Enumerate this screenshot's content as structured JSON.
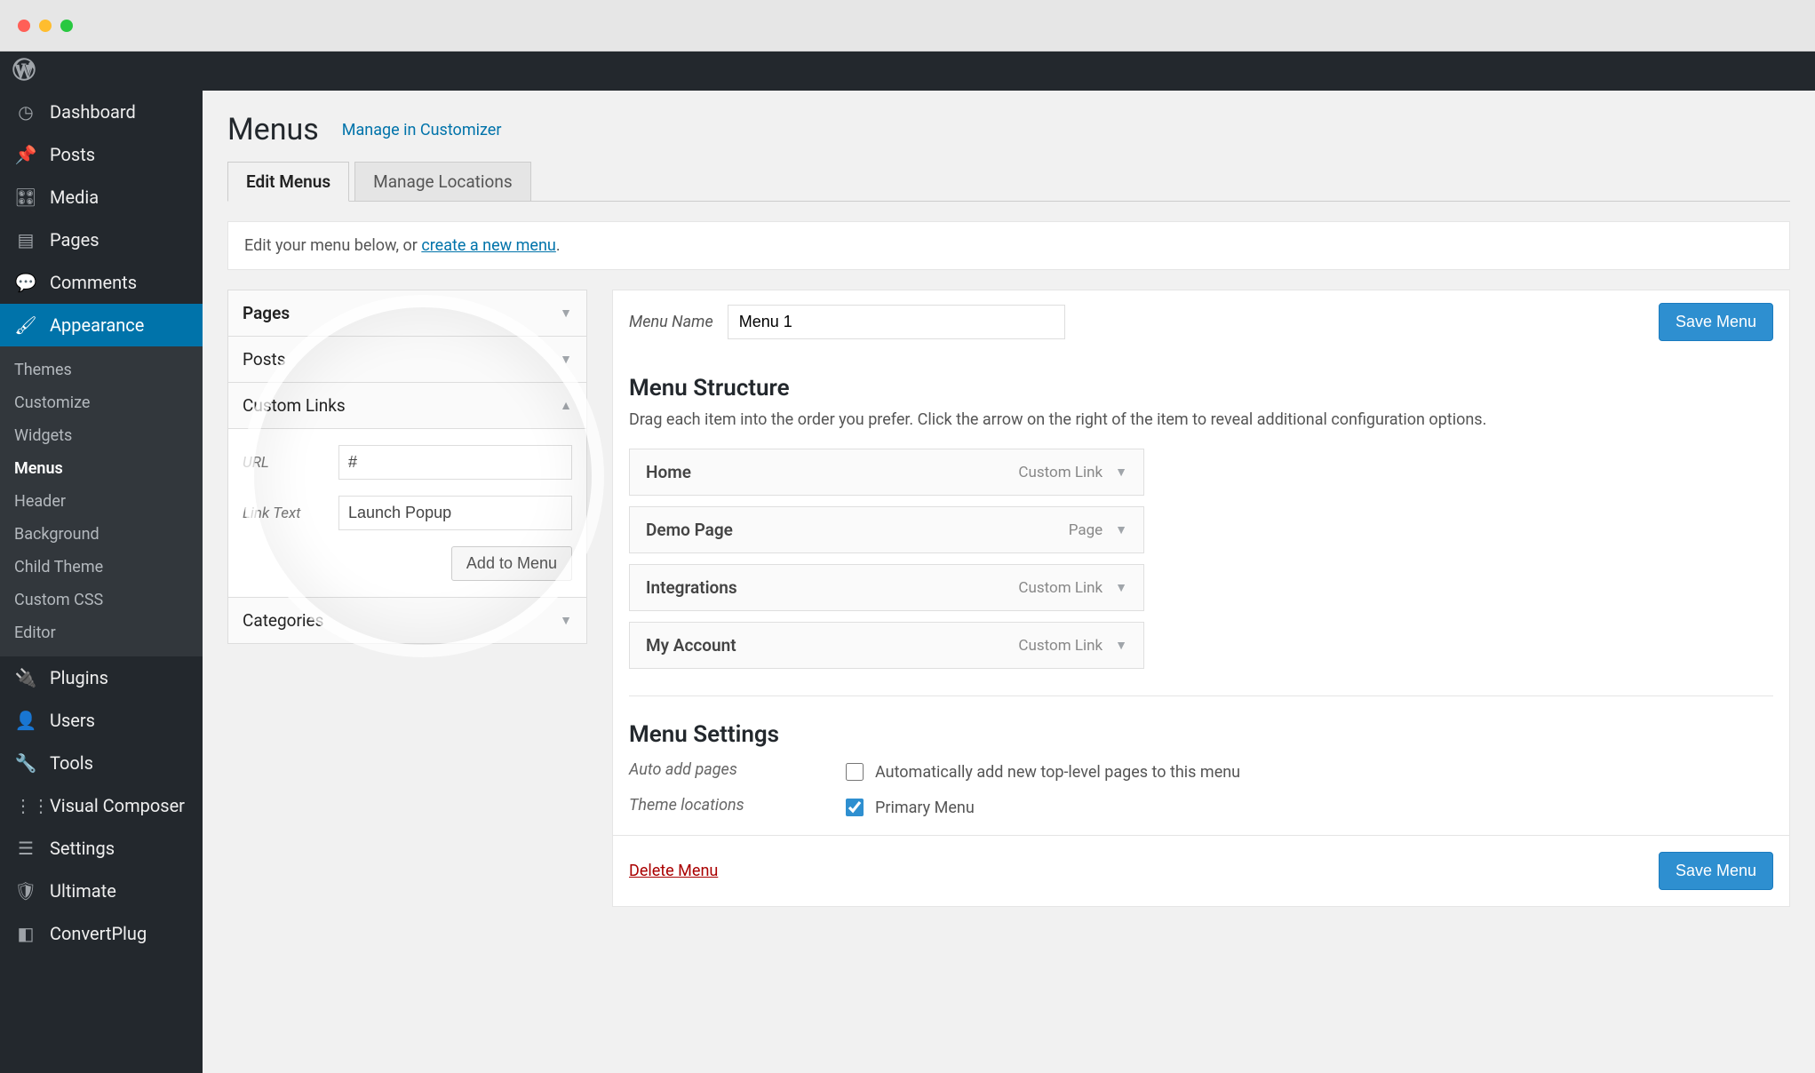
{
  "sidebar": {
    "items": [
      {
        "icon": "gauge",
        "label": "Dashboard"
      },
      {
        "icon": "pin",
        "label": "Posts"
      },
      {
        "icon": "media",
        "label": "Media"
      },
      {
        "icon": "pages",
        "label": "Pages"
      },
      {
        "icon": "comment",
        "label": "Comments"
      },
      {
        "icon": "brush",
        "label": "Appearance",
        "active": true
      },
      {
        "icon": "plug",
        "label": "Plugins"
      },
      {
        "icon": "user",
        "label": "Users"
      },
      {
        "icon": "wrench",
        "label": "Tools"
      },
      {
        "icon": "vc",
        "label": "Visual Composer"
      },
      {
        "icon": "sliders",
        "label": "Settings"
      },
      {
        "icon": "shield",
        "label": "Ultimate"
      },
      {
        "icon": "cp",
        "label": "ConvertPlug"
      }
    ],
    "appearance_children": [
      {
        "label": "Themes"
      },
      {
        "label": "Customize"
      },
      {
        "label": "Widgets"
      },
      {
        "label": "Menus",
        "current": true
      },
      {
        "label": "Header"
      },
      {
        "label": "Background"
      },
      {
        "label": "Child Theme"
      },
      {
        "label": "Custom CSS"
      },
      {
        "label": "Editor"
      }
    ]
  },
  "page": {
    "title": "Menus",
    "manage_link": "Manage in Customizer",
    "tabs": [
      {
        "label": "Edit Menus",
        "active": true
      },
      {
        "label": "Manage Locations"
      }
    ],
    "notice_pre": "Edit your menu below, or ",
    "notice_link": "create a new menu",
    "notice_post": "."
  },
  "accordion": [
    {
      "title": "Pages",
      "open": false,
      "bold": true
    },
    {
      "title": "Posts",
      "open": false,
      "bold": false
    },
    {
      "title": "Custom Links",
      "open": true,
      "bold": false,
      "fields": {
        "url_label": "URL",
        "url_value": "#",
        "text_label": "Link Text",
        "text_value": "Launch Popup",
        "btn": "Add to Menu"
      }
    },
    {
      "title": "Categories",
      "open": false,
      "bold": false
    }
  ],
  "editor": {
    "menu_name_label": "Menu Name",
    "menu_name_value": "Menu 1",
    "save_btn": "Save Menu",
    "structure_heading": "Menu Structure",
    "structure_hint": "Drag each item into the order you prefer. Click the arrow on the right of the item to reveal additional configuration options.",
    "items": [
      {
        "title": "Home",
        "type": "Custom Link"
      },
      {
        "title": "Demo Page",
        "type": "Page"
      },
      {
        "title": "Integrations",
        "type": "Custom Link"
      },
      {
        "title": "My Account",
        "type": "Custom Link"
      }
    ],
    "settings_heading": "Menu Settings",
    "settings": [
      {
        "name": "Auto add pages",
        "options": [
          {
            "label": "Automatically add new top-level pages to this menu",
            "checked": false
          }
        ]
      },
      {
        "name": "Theme locations",
        "options": [
          {
            "label": "Primary Menu",
            "checked": true
          }
        ]
      }
    ],
    "delete": "Delete Menu"
  }
}
